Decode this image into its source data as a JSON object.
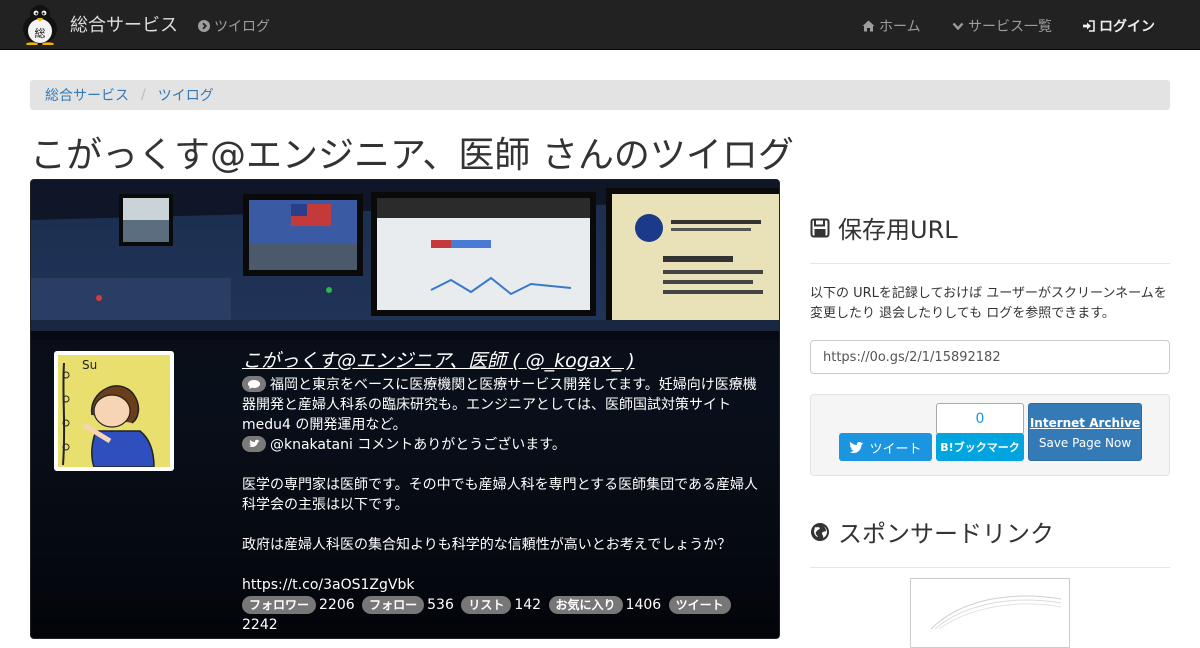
{
  "navbar": {
    "brand": "総合サービス",
    "logo_icon": "penguin-logo-icon",
    "app_link": "ツイログ",
    "home": "ホーム",
    "services": "サービス一覧",
    "login": "ログイン"
  },
  "breadcrumb": {
    "items": [
      "総合サービス",
      "ツイログ"
    ]
  },
  "page": {
    "title": "こがっくす@エンジニア、医師 さんのツイログ"
  },
  "profile": {
    "display_name": "こがっくす@エンジニア、医師 ( @_kogax_ )",
    "bio": "福岡と東京をベースに医療機関と医療サービス開発してます。妊婦向け医療機器開発と産婦人科系の臨床研究も。エンジニアとしては、医師国試対策サイト medu4 の開発運用など。",
    "latest_reply": "@knakatani コメントありがとうございます。",
    "tweet_line1": "医学の専門家は医師です。その中でも産婦人科を専門とする医師集団である産婦人科学会の主張は以下です。",
    "tweet_line2": "政府は産婦人科医の集合知よりも科学的な信頼性が高いとお考えでしょうか？",
    "tweet_link": "https://t.co/3aOS1ZgVbk",
    "stats": [
      {
        "label": "フォロワー",
        "value": "2206"
      },
      {
        "label": "フォロー",
        "value": "536"
      },
      {
        "label": "リスト",
        "value": "142"
      },
      {
        "label": "お気に入り",
        "value": "1406"
      },
      {
        "label": "ツイート",
        "value": "2242"
      }
    ]
  },
  "sidebar": {
    "save_heading": "保存用URL",
    "save_description": "以下の URLを記録しておけば ユーザーがスクリーンネームを変更したり 退会したりしても ログを参照できます。",
    "save_url": "https://0o.gs/2/1/15892182",
    "tweet_button": "ツイート",
    "hatena_count": "0",
    "hatena_button": "B!ブックマーク",
    "ia_title": "Internet Archive",
    "ia_action": "Save Page Now",
    "sponsor_heading": "スポンサードリンク"
  },
  "colors": {
    "navbar_bg": "#222222",
    "link": "#337ab7",
    "twitter": "#1b95e0",
    "hatena": "#00a4de"
  }
}
